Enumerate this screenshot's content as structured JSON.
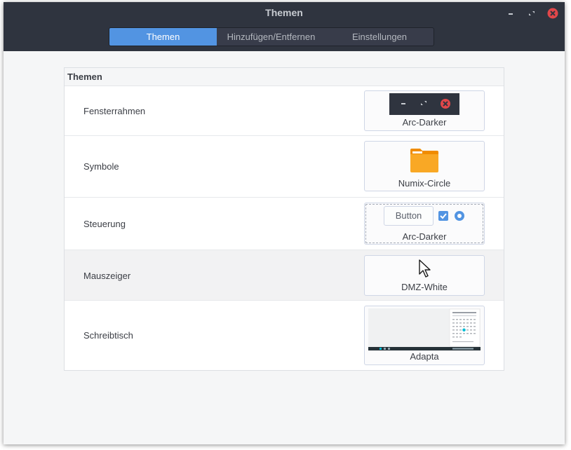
{
  "window": {
    "title": "Themen"
  },
  "tabs": [
    {
      "label": "Themen",
      "active": true
    },
    {
      "label": "Hinzufügen/Entfernen",
      "active": false
    },
    {
      "label": "Einstellungen",
      "active": false
    }
  ],
  "panel": {
    "header": "Themen",
    "rows": [
      {
        "label": "Fensterrahmen",
        "theme": "Arc-Darker",
        "preview_icon": "window-buttons-icon"
      },
      {
        "label": "Symbole",
        "theme": "Numix-Circle",
        "preview_icon": "folder-icon"
      },
      {
        "label": "Steuerung",
        "theme": "Arc-Darker",
        "preview_button": "Button",
        "preview_icon": "controls-icon"
      },
      {
        "label": "Mauszeiger",
        "theme": "DMZ-White",
        "preview_icon": "mouse-pointer-icon"
      },
      {
        "label": "Schreibtisch",
        "theme": "Adapta",
        "preview_icon": "desktop-screenshot-icon"
      }
    ]
  },
  "colors": {
    "titlebar": "#2f343f",
    "accent": "#5294e2",
    "close": "#e1474a",
    "folder": "#f9a825"
  }
}
